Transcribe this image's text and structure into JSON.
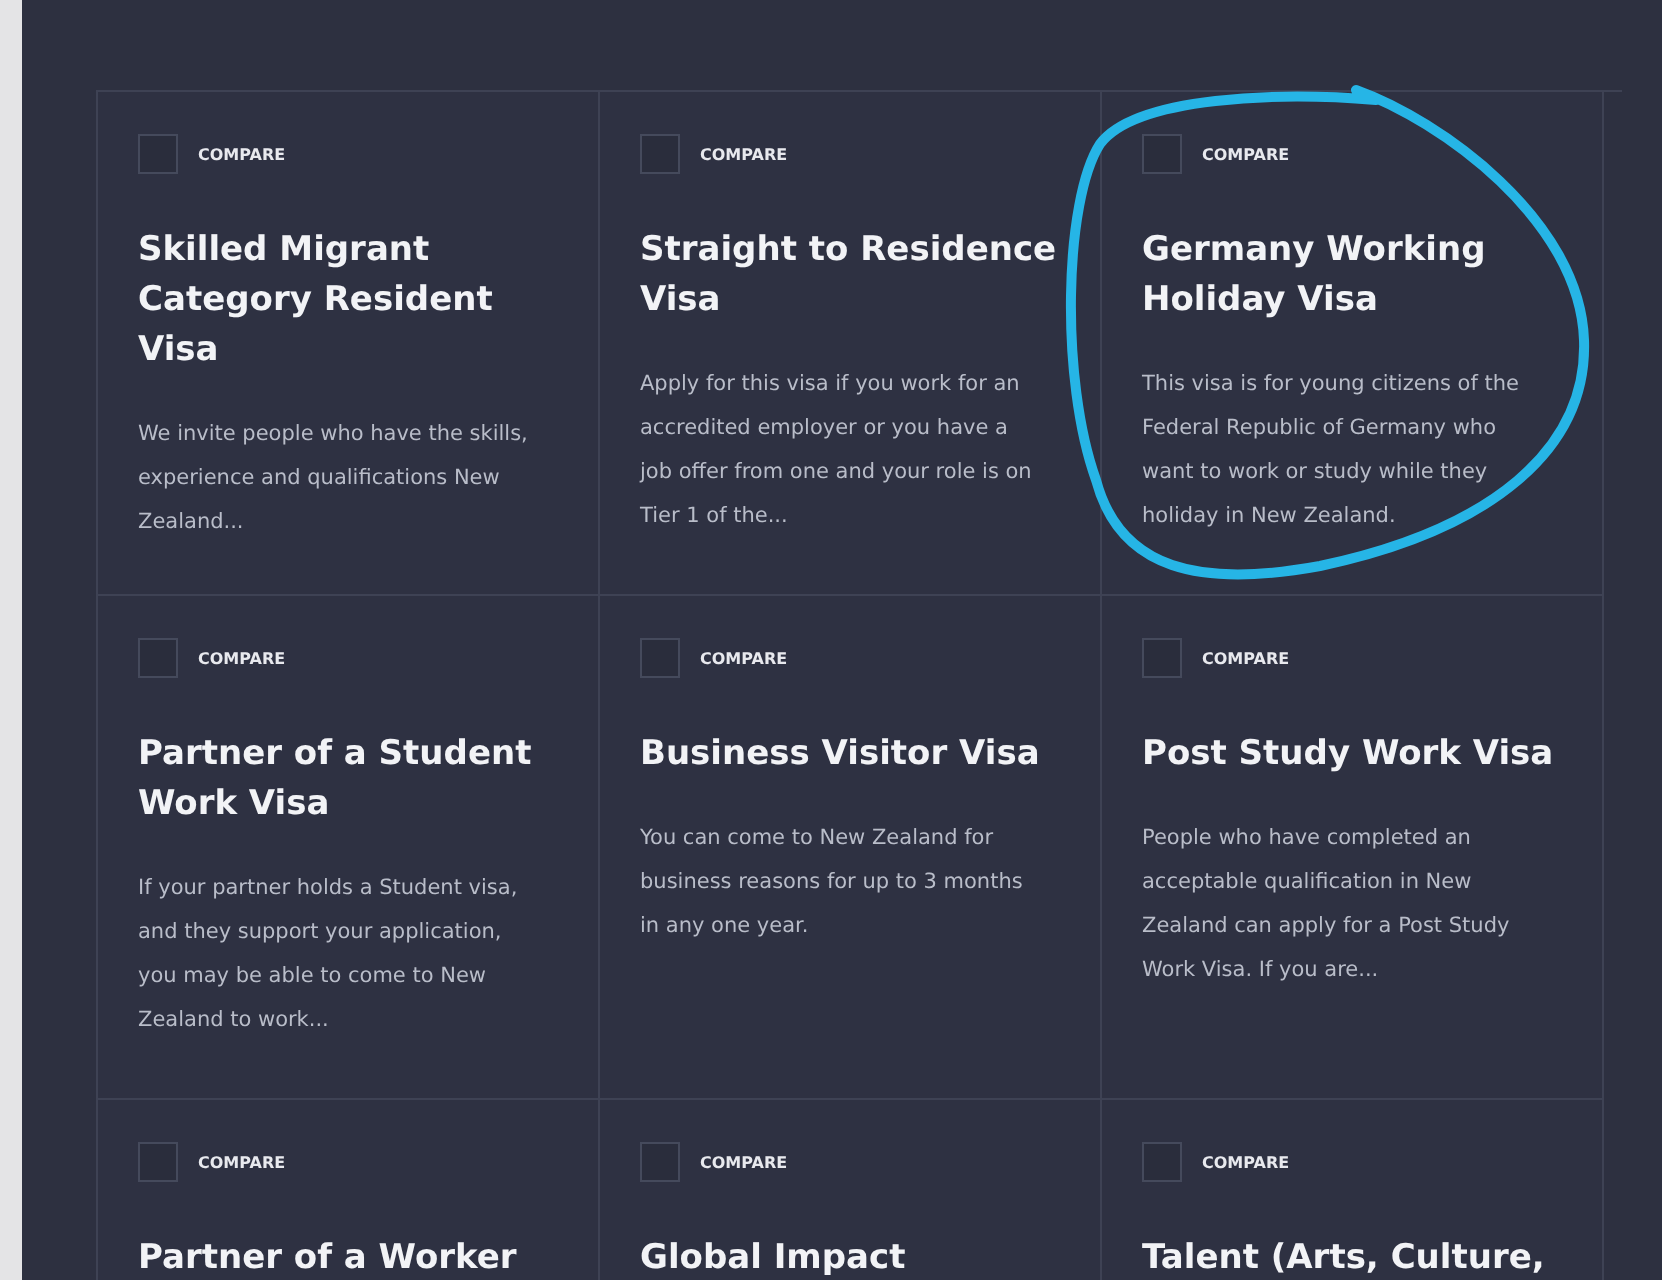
{
  "cards": [
    {
      "compare_label": "COMPARE",
      "checked": false,
      "title": "Skilled Migrant Category Resident Visa",
      "description": "We invite people who have the skills, experience and qualifications New Zealand..."
    },
    {
      "compare_label": "COMPARE",
      "checked": false,
      "title": "Straight to Residence Visa",
      "description": "Apply for this visa if you work for an accredited employer or you have a job offer from one and your role is on Tier 1 of the..."
    },
    {
      "compare_label": "COMPARE",
      "checked": false,
      "title": "Germany Working Holiday Visa",
      "description": "This visa is for young citizens of the Federal Republic of Germany who want to work or study while they holiday in New Zealand."
    },
    {
      "compare_label": "COMPARE",
      "checked": false,
      "title": "Partner of a Student Work Visa",
      "description": "If your partner holds a Student visa, and they support your application, you may be able to come to New Zealand to work..."
    },
    {
      "compare_label": "COMPARE",
      "checked": false,
      "title": "Business Visitor Visa",
      "description": "You can come to New Zealand for business reasons for up to 3 months in any one year."
    },
    {
      "compare_label": "COMPARE",
      "checked": false,
      "title": "Post Study Work Visa",
      "description": "People who have completed an acceptable qualification in New Zealand can apply for a Post Study Work Visa. If you are..."
    },
    {
      "compare_label": "COMPARE",
      "checked": false,
      "title": "Partner of a Worker"
    },
    {
      "compare_label": "COMPARE",
      "checked": false,
      "title": "Global Impact"
    },
    {
      "compare_label": "COMPARE",
      "checked": false,
      "title": "Talent (Arts, Culture,"
    }
  ]
}
